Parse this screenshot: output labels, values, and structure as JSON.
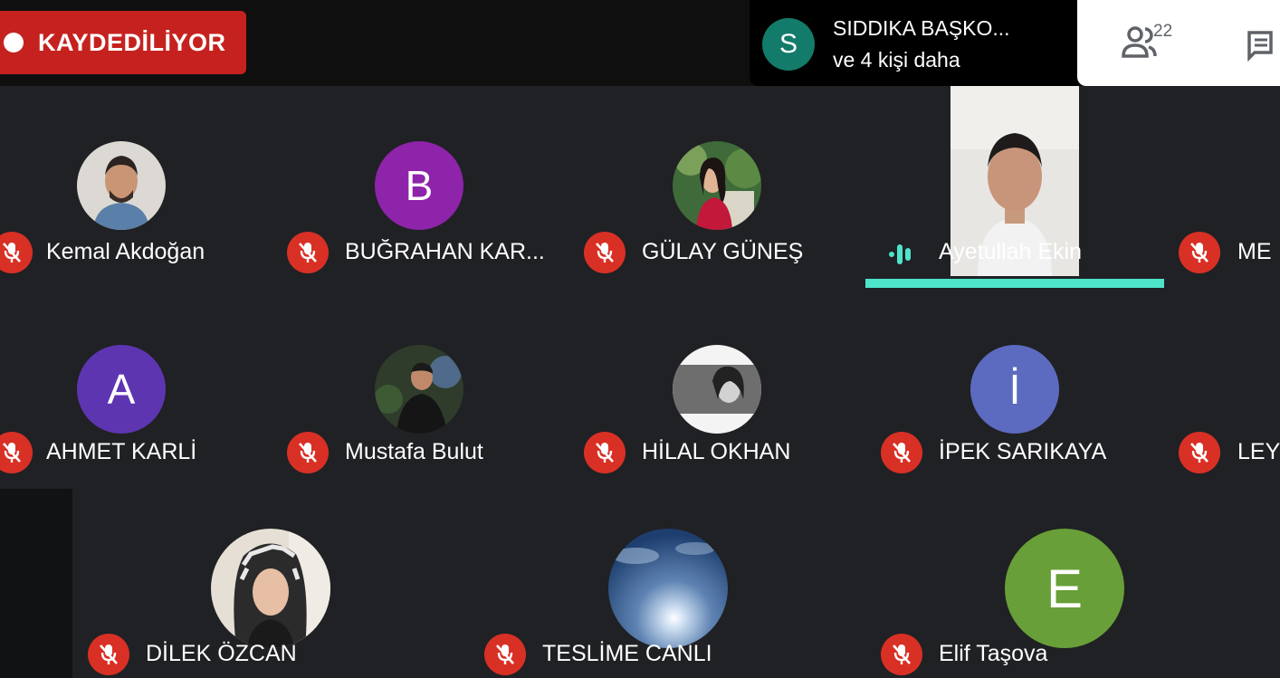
{
  "recording": {
    "label": "KAYDEDİLİYOR"
  },
  "presenter": {
    "initial": "S",
    "name": "SIDDIKA BAŞKO...",
    "others": "ve 4 kişi daha"
  },
  "controls": {
    "participant_count": "22"
  },
  "colors": {
    "muted": "#d93025",
    "speaking": "#4de4ca",
    "recording": "#c5221f"
  },
  "participants": [
    {
      "name": "Kemal Akdoğan",
      "avatar": "photo",
      "muted": true
    },
    {
      "name": "BUĞRAHAN KAR...",
      "avatar": "initial",
      "initial": "B",
      "color": "#8e24aa",
      "muted": true
    },
    {
      "name": "GÜLAY GÜNEŞ",
      "avatar": "photo",
      "muted": true
    },
    {
      "name": "Ayetullah Ekin",
      "avatar": "video",
      "muted": false,
      "speaking": true
    },
    {
      "name": "ME",
      "avatar": "none",
      "muted": true
    },
    {
      "name": "AHMET KARLİ",
      "avatar": "initial",
      "initial": "A",
      "color": "#5e35b1",
      "muted": true
    },
    {
      "name": "Mustafa Bulut",
      "avatar": "photo",
      "muted": true
    },
    {
      "name": "HİLAL OKHAN",
      "avatar": "photo",
      "muted": true
    },
    {
      "name": "İPEK SARIKAYA",
      "avatar": "initial",
      "initial": "İ",
      "color": "#5c6bc0",
      "muted": true
    },
    {
      "name": "LEY",
      "avatar": "none",
      "muted": true
    },
    {
      "name": "DİLEK ÖZCAN",
      "avatar": "photo",
      "muted": true
    },
    {
      "name": "TESLİME CANLI",
      "avatar": "photo",
      "muted": true
    },
    {
      "name": "Elif Taşova",
      "avatar": "initial",
      "initial": "E",
      "color": "#689f38",
      "muted": true
    }
  ]
}
